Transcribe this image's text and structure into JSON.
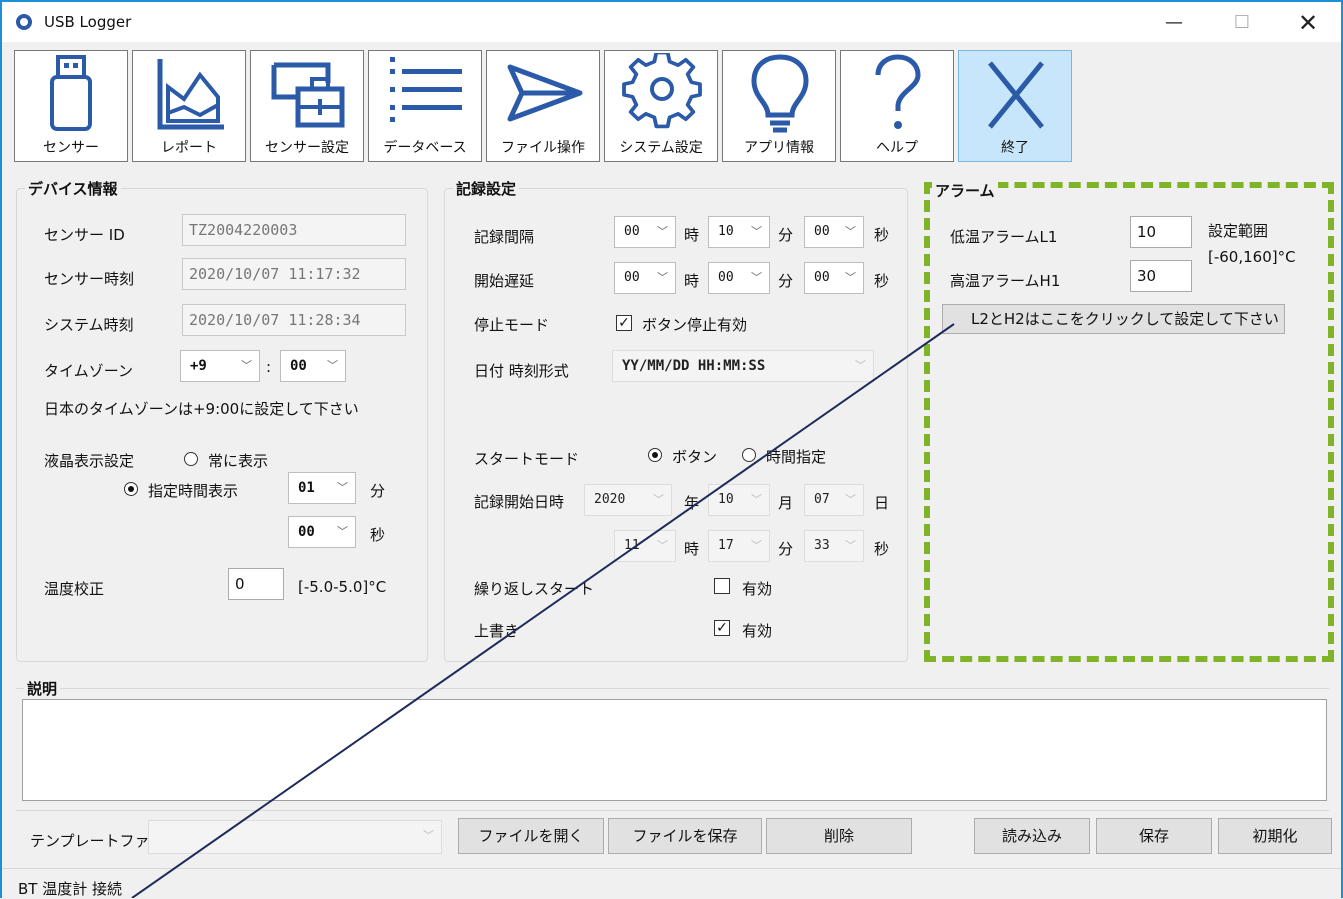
{
  "window": {
    "title": "USB Logger",
    "min": "—",
    "max": "☐",
    "close": "✕"
  },
  "toolbar": [
    {
      "label": "センサー",
      "icon": "usb-stick-icon"
    },
    {
      "label": "レポート",
      "icon": "area-chart-icon"
    },
    {
      "label": "センサー設定",
      "icon": "monitor-lock-icon"
    },
    {
      "label": "データベース",
      "icon": "list-icon"
    },
    {
      "label": "ファイル操作",
      "icon": "send-icon"
    },
    {
      "label": "システム設定",
      "icon": "gear-icon"
    },
    {
      "label": "アプリ情報",
      "icon": "lightbulb-icon"
    },
    {
      "label": "ヘルプ",
      "icon": "question-icon"
    },
    {
      "label": "終了",
      "icon": "close-icon"
    }
  ],
  "device": {
    "title": "デバイス情報",
    "sensor_id_label": "センサー ID",
    "sensor_id": "TZ2004220003",
    "sensor_time_label": "センサー時刻",
    "sensor_time": "2020/10/07 11:17:32",
    "system_time_label": "システム時刻",
    "system_time": "2020/10/07 11:28:34",
    "timezone_label": "タイムゾーン",
    "tz_hour": "+9",
    "tz_sep": ":",
    "tz_min": "00",
    "tz_note": "日本のタイムゾーンは+9:00に設定して下さい",
    "lcd_label": "液晶表示設定",
    "lcd_always": "常に表示",
    "lcd_timed": "指定時間表示",
    "lcd_min": "01",
    "lcd_min_unit": "分",
    "lcd_sec": "00",
    "lcd_sec_unit": "秒",
    "calib_label": "温度校正",
    "calib_value": "0",
    "calib_range": "[-5.0-5.0]°C"
  },
  "record": {
    "title": "記録設定",
    "interval_label": "記録間隔",
    "interval_h": "00",
    "interval_m": "10",
    "interval_s": "00",
    "delay_label": "開始遅延",
    "delay_h": "00",
    "delay_m": "00",
    "delay_s": "00",
    "unit_h": "時",
    "unit_m": "分",
    "unit_s": "秒",
    "stop_label": "停止モード",
    "stop_button": "ボタン停止有効",
    "datefmt_label": "日付 時刻形式",
    "datefmt": "YY/MM/DD HH:MM:SS",
    "start_label": "スタートモード",
    "start_button": "ボタン",
    "start_time": "時間指定",
    "startdate_label": "記録開始日時",
    "year": "2020",
    "year_unit": "年",
    "month": "10",
    "month_unit": "月",
    "day": "07",
    "day_unit": "日",
    "hour": "11",
    "minute": "17",
    "minute_unit": "分",
    "second": "33",
    "second_unit": "秒",
    "repeat_label": "繰り返しスタート",
    "repeat": "有効",
    "overwrite_label": "上書き",
    "overwrite": "有効"
  },
  "alarm": {
    "title": "アラーム",
    "low_label": "低温アラームL1",
    "low": "10",
    "high_label": "高温アラームH1",
    "high": "30",
    "range_label": "設定範囲",
    "range": "[-60,160]°C",
    "l2h2_button": "L2とH2はここをクリックして設定して下さい"
  },
  "description": {
    "title": "説明"
  },
  "bottom": {
    "template_label": "テンプレートファイル",
    "open": "ファイルを開く",
    "save_file": "ファイルを保存",
    "delete": "削除",
    "load": "読み込み",
    "save": "保存",
    "reset": "初期化"
  },
  "status": {
    "text": "BT 温度計 接続"
  }
}
